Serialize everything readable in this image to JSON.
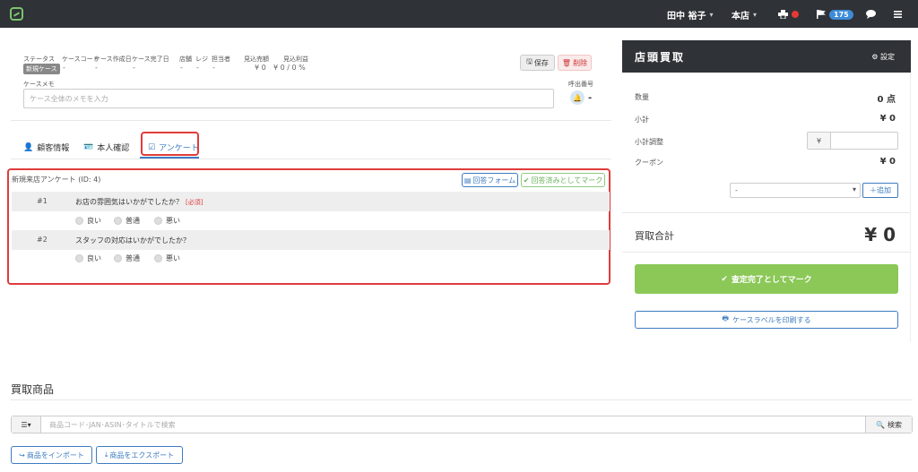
{
  "topbar": {
    "user": "田中 裕子",
    "store": "本店",
    "notification_count": "175"
  },
  "case": {
    "labels": {
      "status": "ステータス",
      "case_code": "ケースコード",
      "created": "ケース作成日",
      "completed": "ケース完了日",
      "store": "店舗",
      "register": "レジ",
      "staff": "担当者",
      "expected_sales": "見込売額",
      "expected_profit": "見込利益",
      "memo": "ケースメモ",
      "call_number": "呼出番号"
    },
    "values": {
      "status": "新規ケース",
      "case_code": "-",
      "created": "-",
      "completed": "-",
      "store": "-",
      "register": "-",
      "staff": "-",
      "expected_sales": "¥ 0",
      "expected_profit": "¥ 0 / 0 %",
      "call_number": "-"
    },
    "memo_placeholder": "ケース全体のメモを入力",
    "save_label": "保存",
    "delete_label": "削除"
  },
  "tabs": [
    {
      "label": "顧客情報"
    },
    {
      "label": "本人確認"
    },
    {
      "label": "アンケート"
    }
  ],
  "survey": {
    "title": "新規来店アンケート (ID: 4)",
    "form_button": "回答フォーム",
    "mark_button": "回答済みとしてマーク",
    "required_label": "[必須]",
    "questions": [
      {
        "num": "#1",
        "text": "お店の雰囲気はいかがでしたか？",
        "options": [
          "良い",
          "普通",
          "悪い"
        ]
      },
      {
        "num": "#2",
        "text": "スタッフの対応はいかがでしたか？",
        "options": [
          "良い",
          "普通",
          "悪い"
        ]
      }
    ]
  },
  "products": {
    "title": "買取商品",
    "search_placeholder": "商品コード･JAN･ASIN･タイトルで検索",
    "search_button": "検索",
    "import_button": "商品をインポート",
    "export_button": "商品をエクスポート"
  },
  "panel": {
    "title": "店頭買取",
    "settings": "設定",
    "quantity_label": "数量",
    "quantity_value": "0 点",
    "subtotal_label": "小計",
    "subtotal_value": "¥ 0",
    "adjust_label": "小計調整",
    "adjust_unit": "¥",
    "coupon_label": "クーポン",
    "coupon_value": "¥ 0",
    "coupon_select": "-",
    "add_button": "追加",
    "total_label": "買取合計",
    "total_value": "¥ 0",
    "complete_button": "査定完了としてマーク",
    "print_button": "ケースラベルを印刷する"
  },
  "colors": {
    "header_bg": "#2f3236",
    "accent": "#3d7cc0",
    "success": "#8bc858",
    "danger": "#e03c3c",
    "badge": "#3d8bd8"
  }
}
